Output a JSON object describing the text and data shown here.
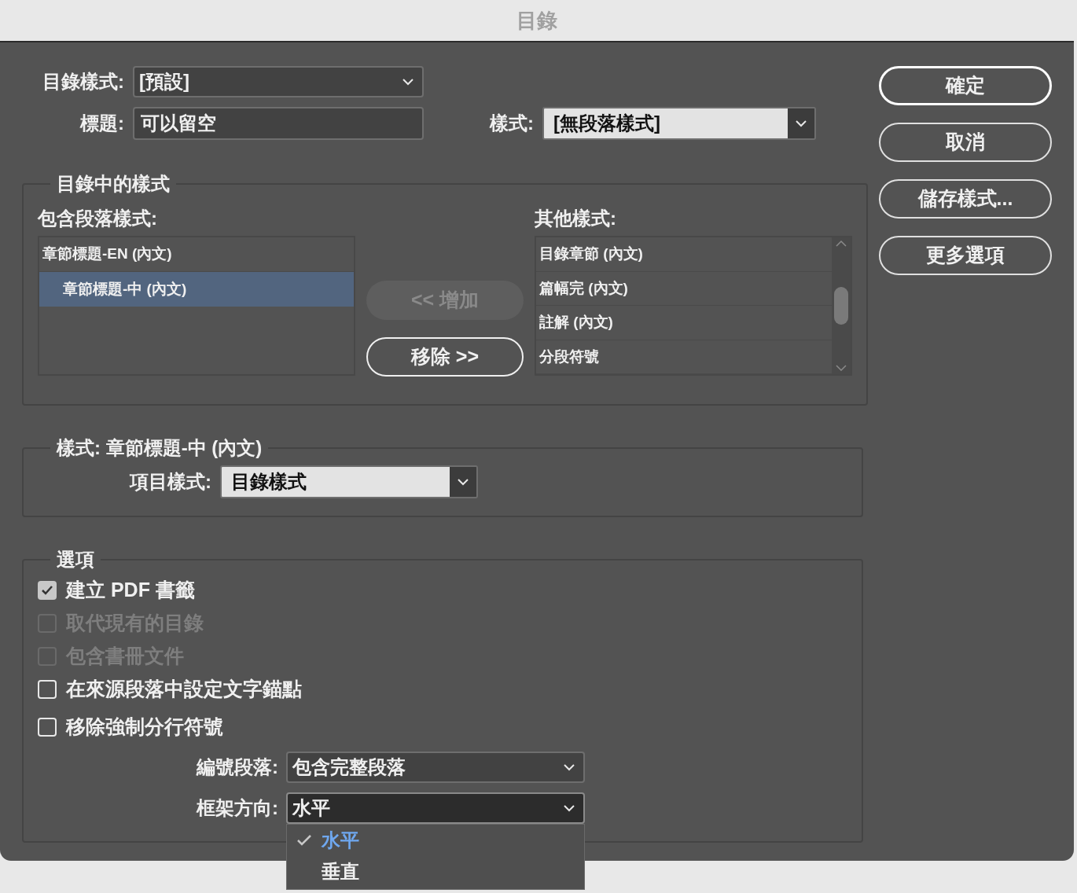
{
  "window": {
    "title": "目錄"
  },
  "toc_style": {
    "label": "目錄樣式:",
    "value": "[預設]"
  },
  "title": {
    "label": "標題:",
    "value": "可以留空"
  },
  "title_style": {
    "label": "樣式:",
    "value": "[無段落樣式]"
  },
  "styles_group": {
    "title": "目錄中的樣式",
    "included_label": "包含段落樣式:",
    "included": [
      {
        "text": "章節標題-EN (內文)",
        "selected": false,
        "children": [
          {
            "text": "章節標題-中 (內文)",
            "selected": true
          }
        ]
      }
    ],
    "add_button": {
      "label": "<< 增加",
      "disabled": true
    },
    "remove_button": {
      "label": "移除 >>",
      "disabled": false
    },
    "other_label": "其他樣式:",
    "other": [
      {
        "text": "目錄章節 (內文)",
        "selected": false
      },
      {
        "text": "篇幅完 (內文)",
        "selected": false
      },
      {
        "text": "註解 (內文)",
        "selected": false
      },
      {
        "text": "分段符號",
        "selected": false
      }
    ]
  },
  "style_group": {
    "title": "樣式: 章節標題-中 (內文)",
    "entry_style": {
      "label": "項目樣式:",
      "value": "目錄樣式"
    }
  },
  "options": {
    "title": "選項",
    "checkboxes": [
      {
        "label": "建立 PDF 書籤",
        "checked": true,
        "disabled": false
      },
      {
        "label": "取代現有的目錄",
        "checked": false,
        "disabled": true
      },
      {
        "label": "包含書冊文件",
        "checked": false,
        "disabled": true
      },
      {
        "label": "在來源段落中設定文字錨點",
        "checked": false,
        "disabled": false
      },
      {
        "label": "移除強制分行符號",
        "checked": false,
        "disabled": false
      }
    ],
    "numbered": {
      "label": "編號段落:",
      "value": "包含完整段落"
    },
    "frame_direction": {
      "label": "框架方向:",
      "value": "水平",
      "expanded": true,
      "menu": [
        {
          "text": "水平",
          "selected": true
        },
        {
          "text": "垂直",
          "selected": false
        }
      ]
    }
  },
  "buttons": [
    {
      "label": "確定",
      "default": true
    },
    {
      "label": "取消",
      "default": false
    },
    {
      "label": "儲存樣式...",
      "default": false
    },
    {
      "label": "更多選項",
      "default": false
    }
  ]
}
